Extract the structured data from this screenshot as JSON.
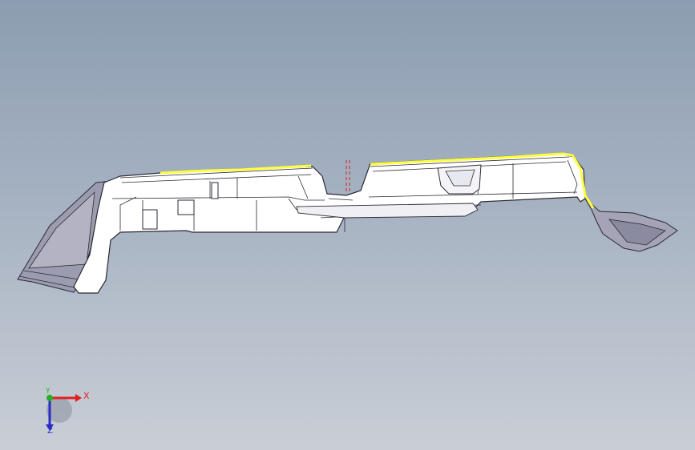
{
  "viewport": {
    "background_top": "#8c9db1",
    "background_bottom": "#c9ced6"
  },
  "triad": {
    "x_label": "X",
    "y_label": "Y",
    "z_label": "Z",
    "x_color": "#e02020",
    "y_color": "#21b321",
    "z_color": "#2a2ac8"
  },
  "model": {
    "edge_color": "#2a2a34",
    "face_color": "#ffffff",
    "shade_color": "#9a9aae",
    "highlight_color": "#ffff3c",
    "sketch_color": "#e02020"
  }
}
